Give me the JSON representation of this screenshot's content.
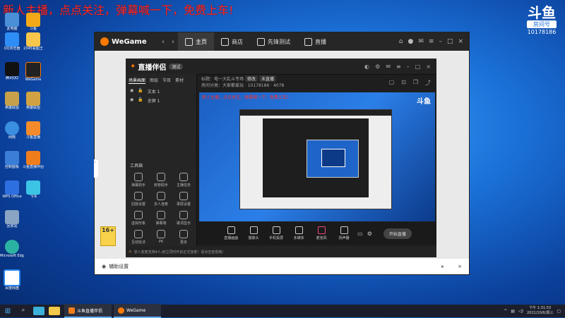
{
  "overlay_text": "新人主播，点点关注，弹幕喊一下，免费上车!",
  "douyu": {
    "logo": "斗鱼",
    "tag": "房间号",
    "room_id": "10178186"
  },
  "desktop_icons": [
    {
      "label": "此电脑",
      "color": "#4a90d9"
    },
    {
      "label": "斗鱼",
      "color": "#f3a917"
    },
    {
      "label": "QQ浏览器",
      "color": "#2f8ef5"
    },
    {
      "label": "2345看图王",
      "color": "#f7c64a"
    },
    {
      "label": "腾讯QQ",
      "color": "#111111"
    },
    {
      "label": "WeGame",
      "color": "#ff7a00"
    },
    {
      "label": "英雄联盟",
      "color": "#c7a14a"
    },
    {
      "label": "英雄联盟",
      "color": "#d0a242"
    },
    {
      "label": "网络",
      "color": "#3b8fe0"
    },
    {
      "label": "斗鱼直播",
      "color": "#f48b2b"
    },
    {
      "label": "控制面板",
      "color": "#3a7ed8"
    },
    {
      "label": "斗鱼直播伴侣",
      "color": "#f07d1c"
    },
    {
      "label": "WPS Office",
      "color": "#2e6fe0"
    },
    {
      "label": "飞书",
      "color": "#3cc4e6"
    },
    {
      "label": "回收站",
      "color": "#8aa4c4"
    },
    {
      "label": "Microsoft Edge",
      "color": "#2bb2a2"
    },
    {
      "label": "百度网盘",
      "color": "#2a87f0"
    }
  ],
  "wegame": {
    "logo": "WeGame",
    "tabs": [
      "主页",
      "商店",
      "先锋测试",
      "直播"
    ],
    "age_badge": "16+",
    "bottom_label": "辅助设置"
  },
  "live": {
    "logo": "直播伴侣",
    "logo_badge": "测试",
    "left_tabs": [
      "场景画面",
      "图层",
      "节目",
      "素材"
    ],
    "scenes": [
      {
        "label": "文本 1"
      },
      {
        "label": "全屏 1"
      }
    ],
    "tools_title": "工具箱",
    "tools": [
      "弹幕助手",
      "房管助手",
      "主播任务",
      "回放设置",
      "多人连麦",
      "录屏设置",
      "虚拟形象",
      "弹幕墙",
      "歌词显示",
      "互动玩法",
      "PK",
      "更多"
    ],
    "room_title": "标题：电一大乱斗专场",
    "chip1": "修改",
    "chip2": "未直播",
    "room_line2": "房间分类：大家都爱玩 · 10178186 · 4078",
    "preview_red": "新人主播，点点关注，弹幕喊一下，免费上车!",
    "preview_logo": "斗鱼",
    "bottom_buttons": [
      "直播画面",
      "摄像头",
      "手机投屏",
      "多媒体",
      "麦克风",
      "扬声器"
    ],
    "start_label": "开始直播",
    "status_text": "求人连麦支持4人,树立同时开启正式连麦！请点击查看哦！"
  },
  "taskbar": {
    "task1": "斗鱼直播伴侣",
    "task2": "WeGame",
    "time": "下午 1:31:53",
    "date": "2021/10/6/周三"
  }
}
